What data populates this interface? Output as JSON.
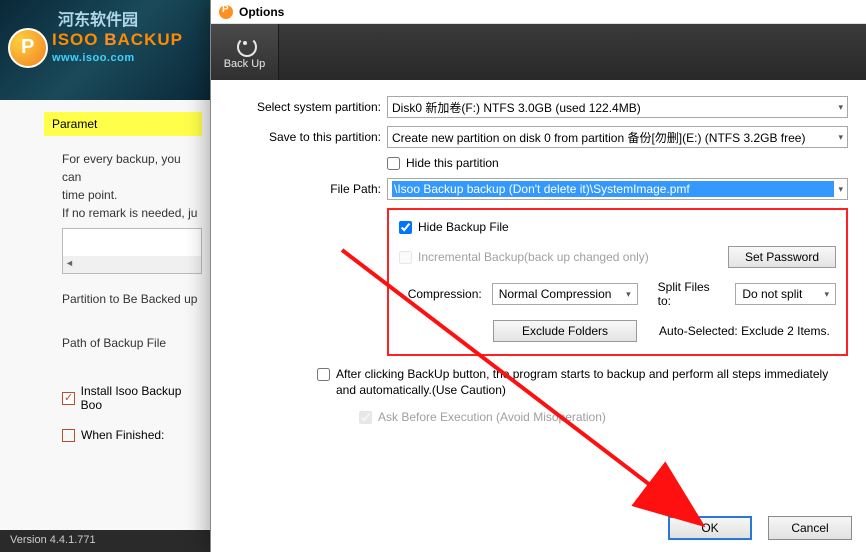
{
  "bg": {
    "cn": "河东软件园",
    "brand_a": "ISOO ",
    "brand_b": "B",
    "brand_c": "ACKUP",
    "url": "www.isoo.com",
    "param_header": "Paramet",
    "desc1": "For every backup, you can",
    "desc2": "time point.",
    "desc3": "If no remark is needed, ju",
    "field1": "Partition to Be Backed up",
    "field2": "Path of Backup File",
    "install_label": "Install Isoo Backup Boo",
    "when_label": "When Finished:",
    "version": "Version 4.4.1.771"
  },
  "modal": {
    "title": "Options",
    "tab_backup": "Back Up",
    "lbl_select": "Select system partition:",
    "val_select": "Disk0  新加卷(F:) NTFS 3.0GB (used 122.4MB)",
    "lbl_save": "Save to this partition:",
    "val_save": "Create new partition on disk 0 from partition 备份[勿删](E:) (NTFS 3.2GB free)",
    "chk_hidepart": "Hide this partition",
    "lbl_filepath": "File Path:",
    "val_filepath": "\\Isoo Backup backup (Don't delete it)\\SystemImage.pmf",
    "chk_hidefile": "Hide Backup File",
    "chk_incremental": "Incremental Backup(back up changed only)",
    "btn_setpw": "Set Password",
    "lbl_compression": "Compression:",
    "val_compression": "Normal Compression",
    "lbl_split": "Split Files to:",
    "val_split": "Do not split",
    "btn_exclude": "Exclude Folders",
    "txt_autoselected": "Auto-Selected: Exclude 2 Items.",
    "chk_after": "After clicking BackUp button, the program starts to backup and perform all steps immediately and automatically.(Use Caution)",
    "chk_ask": "Ask Before Execution (Avoid Misoperation)",
    "btn_ok": "OK",
    "btn_cancel": "Cancel"
  }
}
